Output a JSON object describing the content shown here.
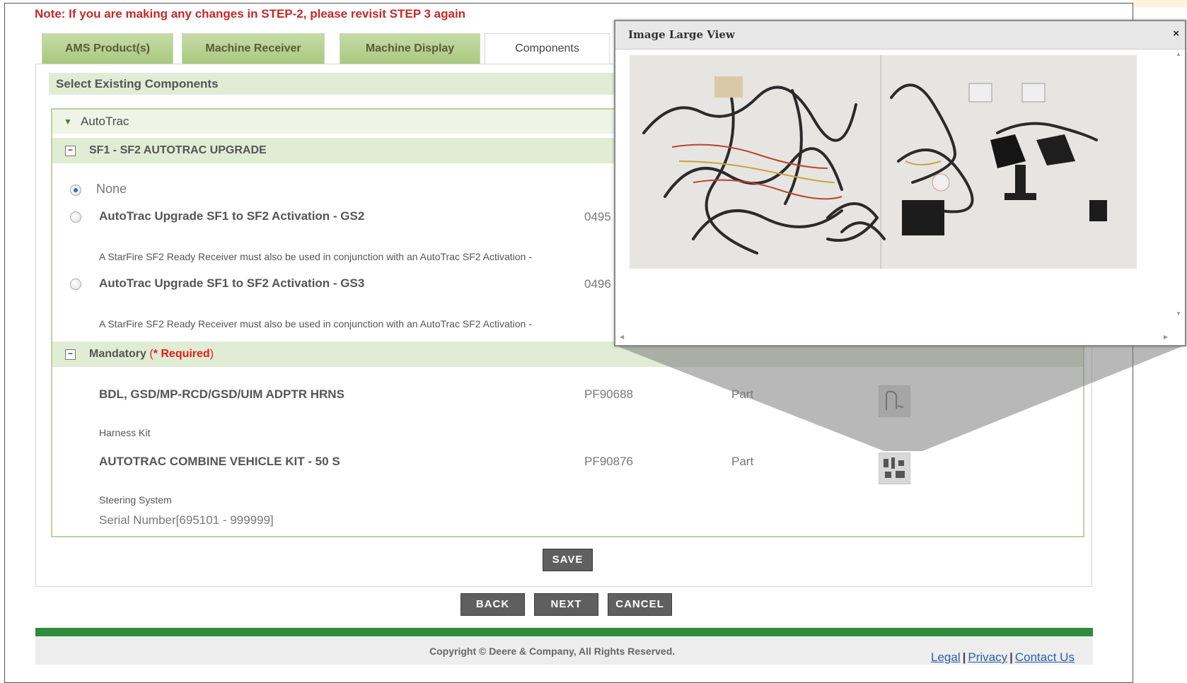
{
  "note": "Note: If you are making any changes in STEP-2, please revisit STEP 3 again",
  "tabs": [
    {
      "label": "AMS Product(s)"
    },
    {
      "label": "Machine Receiver"
    },
    {
      "label": "Machine Display"
    },
    {
      "label": "Components",
      "active": true
    }
  ],
  "section_header": "Select Existing Components",
  "group": {
    "title": "AutoTrac",
    "subgroup_title": "SF1 - SF2 AUTOTRAC UPGRADE",
    "options": [
      {
        "label": "None",
        "selected": true
      },
      {
        "label": "AutoTrac Upgrade SF1 to SF2 Activation - GS2",
        "part": "0495",
        "desc": "A StarFire SF2 Ready Receiver must also be used in conjunction with an AutoTrac SF2 Activation -",
        "selected": false
      },
      {
        "label": "AutoTrac Upgrade SF1 to SF2 Activation - GS3",
        "part": "0496",
        "desc": "A StarFire SF2 Ready Receiver must also be used in conjunction with an AutoTrac SF2 Activation -",
        "selected": false
      }
    ]
  },
  "mandatory": {
    "title": "Mandatory",
    "open_paren": " (",
    "required": "* Required",
    "close_paren": ")",
    "items": [
      {
        "name": "BDL, GSD/MP-RCD/GSD/UIM ADPTR HRNS",
        "part": "PF90688",
        "type": "Part",
        "desc": "Harness Kit"
      },
      {
        "name": "AUTOTRAC COMBINE VEHICLE KIT - 50 S",
        "part": "PF90876",
        "type": "Part",
        "desc": "Steering System",
        "serial": "Serial Number[695101 - 999999]"
      }
    ]
  },
  "buttons": {
    "save": "SAVE",
    "back": "BACK",
    "next": "NEXT",
    "cancel": "CANCEL"
  },
  "footer": {
    "copyright": "Copyright © Deere & Company, All Rights Reserved.",
    "links": [
      "Legal",
      "Privacy",
      "Contact Us"
    ],
    "separator": "|"
  },
  "popup": {
    "title": "Image Large View",
    "close": "×"
  },
  "colors": {
    "accent_green": "#2f8c3a",
    "tab_green": "#b4cf8c",
    "note_red": "#c62828",
    "required_red": "#e21d1d"
  }
}
